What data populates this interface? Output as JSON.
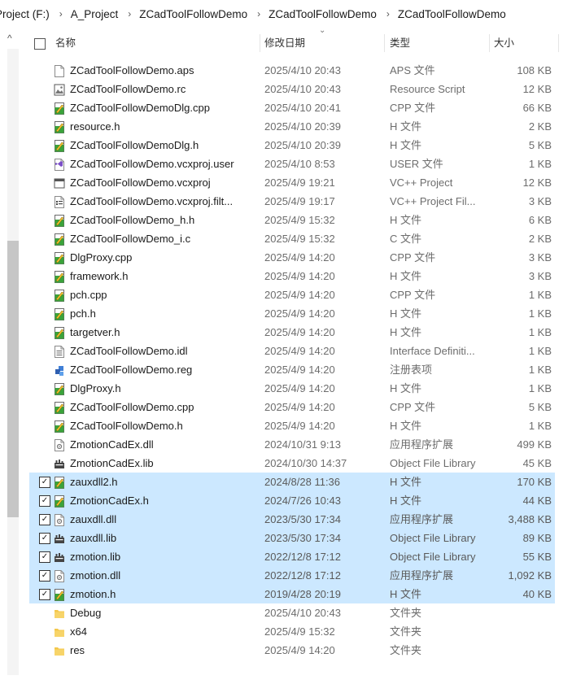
{
  "breadcrumb": [
    "Project (F:)",
    "A_Project",
    "ZCadToolFollowDemo",
    "ZCadToolFollowDemo",
    "ZCadToolFollowDemo"
  ],
  "columns": {
    "name": "名称",
    "modified": "修改日期",
    "type": "类型",
    "size": "大小"
  },
  "rows": [
    {
      "name": "ZCadToolFollowDemo.aps",
      "date": "2025/4/10 20:43",
      "type": "APS 文件",
      "size": "108 KB",
      "icon": "blank-file-icon",
      "selected": false
    },
    {
      "name": "ZCadToolFollowDemo.rc",
      "date": "2025/4/10 20:43",
      "type": "Resource Script",
      "size": "12 KB",
      "icon": "resource-script-icon",
      "selected": false
    },
    {
      "name": "ZCadToolFollowDemoDlg.cpp",
      "date": "2025/4/10 20:41",
      "type": "CPP 文件",
      "size": "66 KB",
      "icon": "code-file-icon",
      "selected": false
    },
    {
      "name": "resource.h",
      "date": "2025/4/10 20:39",
      "type": "H 文件",
      "size": "2 KB",
      "icon": "code-file-icon",
      "selected": false
    },
    {
      "name": "ZCadToolFollowDemoDlg.h",
      "date": "2025/4/10 20:39",
      "type": "H 文件",
      "size": "5 KB",
      "icon": "code-file-icon",
      "selected": false
    },
    {
      "name": "ZCadToolFollowDemo.vcxproj.user",
      "date": "2025/4/10 8:53",
      "type": "USER 文件",
      "size": "1 KB",
      "icon": "visual-studio-icon",
      "selected": false
    },
    {
      "name": "ZCadToolFollowDemo.vcxproj",
      "date": "2025/4/9 19:21",
      "type": "VC++ Project",
      "size": "12 KB",
      "icon": "window-file-icon",
      "selected": false
    },
    {
      "name": "ZCadToolFollowDemo.vcxproj.filt...",
      "date": "2025/4/9 19:17",
      "type": "VC++ Project Fil...",
      "size": "3 KB",
      "icon": "project-filter-icon",
      "selected": false
    },
    {
      "name": "ZCadToolFollowDemo_h.h",
      "date": "2025/4/9 15:32",
      "type": "H 文件",
      "size": "6 KB",
      "icon": "code-file-icon",
      "selected": false
    },
    {
      "name": "ZCadToolFollowDemo_i.c",
      "date": "2025/4/9 15:32",
      "type": "C 文件",
      "size": "2 KB",
      "icon": "code-file-icon",
      "selected": false
    },
    {
      "name": "DlgProxy.cpp",
      "date": "2025/4/9 14:20",
      "type": "CPP 文件",
      "size": "3 KB",
      "icon": "code-file-icon",
      "selected": false
    },
    {
      "name": "framework.h",
      "date": "2025/4/9 14:20",
      "type": "H 文件",
      "size": "3 KB",
      "icon": "code-file-icon",
      "selected": false
    },
    {
      "name": "pch.cpp",
      "date": "2025/4/9 14:20",
      "type": "CPP 文件",
      "size": "1 KB",
      "icon": "code-file-icon",
      "selected": false
    },
    {
      "name": "pch.h",
      "date": "2025/4/9 14:20",
      "type": "H 文件",
      "size": "1 KB",
      "icon": "code-file-icon",
      "selected": false
    },
    {
      "name": "targetver.h",
      "date": "2025/4/9 14:20",
      "type": "H 文件",
      "size": "1 KB",
      "icon": "code-file-icon",
      "selected": false
    },
    {
      "name": "ZCadToolFollowDemo.idl",
      "date": "2025/4/9 14:20",
      "type": "Interface Definiti...",
      "size": "1 KB",
      "icon": "text-file-icon",
      "selected": false
    },
    {
      "name": "ZCadToolFollowDemo.reg",
      "date": "2025/4/9 14:20",
      "type": "注册表项",
      "size": "1 KB",
      "icon": "registry-icon",
      "selected": false
    },
    {
      "name": "DlgProxy.h",
      "date": "2025/4/9 14:20",
      "type": "H 文件",
      "size": "1 KB",
      "icon": "code-file-icon",
      "selected": false
    },
    {
      "name": "ZCadToolFollowDemo.cpp",
      "date": "2025/4/9 14:20",
      "type": "CPP 文件",
      "size": "5 KB",
      "icon": "code-file-icon",
      "selected": false
    },
    {
      "name": "ZCadToolFollowDemo.h",
      "date": "2025/4/9 14:20",
      "type": "H 文件",
      "size": "1 KB",
      "icon": "code-file-icon",
      "selected": false
    },
    {
      "name": "ZmotionCadEx.dll",
      "date": "2024/10/31 9:13",
      "type": "应用程序扩展",
      "size": "499 KB",
      "icon": "dll-file-icon",
      "selected": false
    },
    {
      "name": "ZmotionCadEx.lib",
      "date": "2024/10/30 14:37",
      "type": "Object File Library",
      "size": "45 KB",
      "icon": "lib-file-icon",
      "selected": false
    },
    {
      "name": "zauxdll2.h",
      "date": "2024/8/28 11:36",
      "type": "H 文件",
      "size": "170 KB",
      "icon": "code-file-icon",
      "selected": true
    },
    {
      "name": "ZmotionCadEx.h",
      "date": "2024/7/26 10:43",
      "type": "H 文件",
      "size": "44 KB",
      "icon": "code-file-icon",
      "selected": true
    },
    {
      "name": "zauxdll.dll",
      "date": "2023/5/30 17:34",
      "type": "应用程序扩展",
      "size": "3,488 KB",
      "icon": "dll-file-icon",
      "selected": true
    },
    {
      "name": "zauxdll.lib",
      "date": "2023/5/30 17:34",
      "type": "Object File Library",
      "size": "89 KB",
      "icon": "lib-file-icon",
      "selected": true
    },
    {
      "name": "zmotion.lib",
      "date": "2022/12/8 17:12",
      "type": "Object File Library",
      "size": "55 KB",
      "icon": "lib-file-icon",
      "selected": true
    },
    {
      "name": "zmotion.dll",
      "date": "2022/12/8 17:12",
      "type": "应用程序扩展",
      "size": "1,092 KB",
      "icon": "dll-file-icon",
      "selected": true
    },
    {
      "name": "zmotion.h",
      "date": "2019/4/28 20:19",
      "type": "H 文件",
      "size": "40 KB",
      "icon": "code-file-icon",
      "selected": true
    },
    {
      "name": "Debug",
      "date": "2025/4/10 20:43",
      "type": "文件夹",
      "size": "",
      "icon": "folder-icon",
      "selected": false
    },
    {
      "name": "x64",
      "date": "2025/4/9 15:32",
      "type": "文件夹",
      "size": "",
      "icon": "folder-icon",
      "selected": false
    },
    {
      "name": "res",
      "date": "2025/4/9 14:20",
      "type": "文件夹",
      "size": "",
      "icon": "folder-icon",
      "selected": false
    }
  ],
  "colors": {
    "selection": "#cce8ff",
    "folder": "#f4c74a",
    "code_icon_green": "#3aa33a"
  },
  "glyphs": {
    "check": "✓",
    "chevron_up": "^",
    "sort_down": "⌄",
    "sep": "›"
  }
}
